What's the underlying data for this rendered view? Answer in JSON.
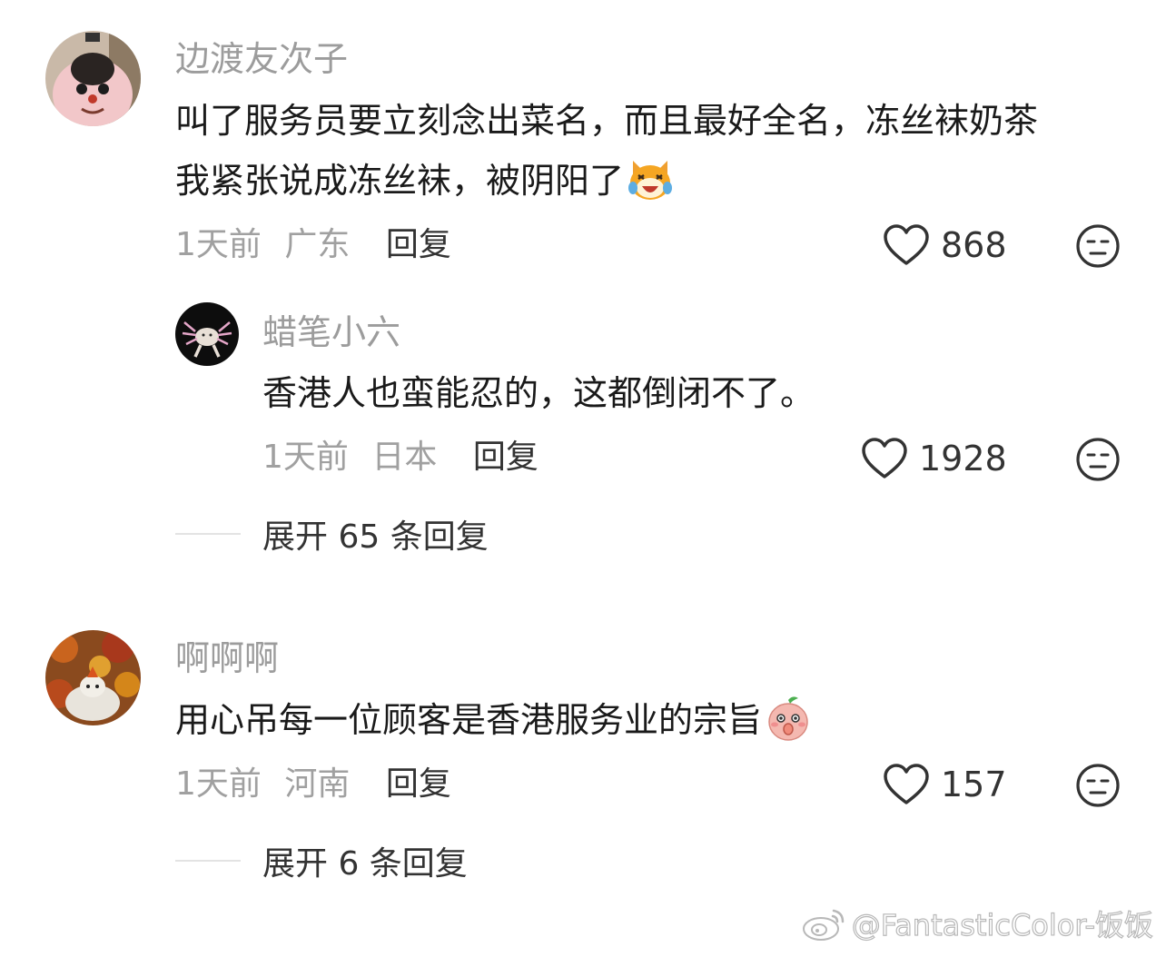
{
  "comments": [
    {
      "username": "边渡友次子",
      "lines": [
        "叫了服务员要立刻念出菜名，而且最好全名，冻丝袜奶茶",
        "我紧张说成冻丝袜，被阴阳了"
      ],
      "emoji": "laughing-cat-emoji",
      "time": "1天前",
      "location": "广东",
      "reply_label": "回复",
      "likes": "868",
      "replies": [
        {
          "username": "蜡笔小六",
          "text": "香港人也蛮能忍的，这都倒闭不了。",
          "time": "1天前",
          "location": "日本",
          "reply_label": "回复",
          "likes": "1928"
        }
      ],
      "expand_label": "展开 65 条回复"
    },
    {
      "username": "啊啊啊",
      "lines": [
        "用心吊每一位顾客是香港服务业的宗旨"
      ],
      "emoji": "peach-shush-emoji",
      "time": "1天前",
      "location": "河南",
      "reply_label": "回复",
      "likes": "157",
      "expand_label": "展开 6 条回复"
    }
  ],
  "watermark": "@FantasticColor-饭饭",
  "colors": {
    "muted": "#9c9c9c",
    "text": "#1a1a1a",
    "icon": "#333333"
  }
}
